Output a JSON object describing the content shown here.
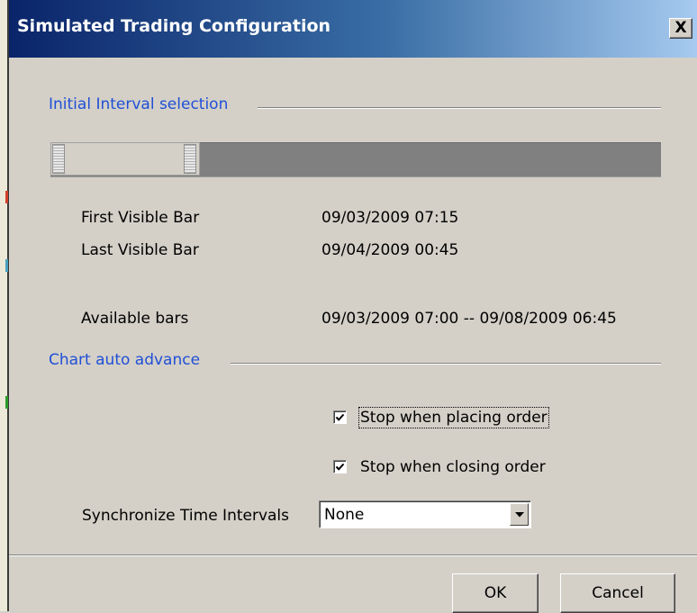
{
  "window": {
    "title": "Simulated Trading Configuration",
    "close_label": "X"
  },
  "initial_interval": {
    "group_label": "Initial Interval selection",
    "first_visible_bar_label": "First Visible Bar",
    "first_visible_bar_value": "09/03/2009 07:15",
    "last_visible_bar_label": "Last Visible Bar",
    "last_visible_bar_value": "09/04/2009 00:45",
    "available_bars_label": "Available bars",
    "available_bars_value": "09/03/2009 07:00 -- 09/08/2009 06:45"
  },
  "auto_advance": {
    "group_label": "Chart auto advance",
    "stop_placing_label": "Stop when placing order",
    "stop_placing_checked": true,
    "stop_closing_label": "Stop when closing order",
    "stop_closing_checked": true
  },
  "sync": {
    "label": "Synchronize Time Intervals",
    "selected": "None"
  },
  "buttons": {
    "ok": "OK",
    "cancel": "Cancel"
  },
  "colors": {
    "title_gradient_start": "#0a246a",
    "group_label": "#1f4fd6",
    "slider_track": "#808080",
    "dialog_face": "#d4d0c8"
  }
}
